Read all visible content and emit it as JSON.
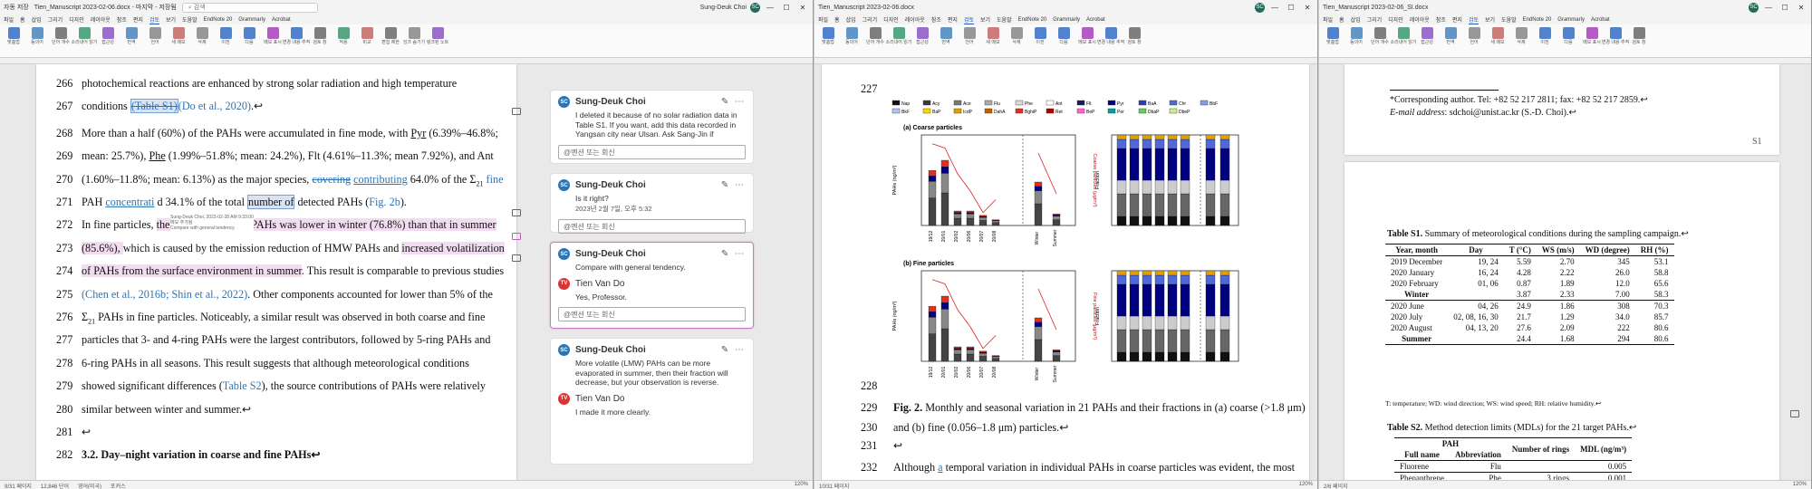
{
  "window1": {
    "title": "Tien_Manuscript 2023-02-06.docx - 마지막 - 저장됨",
    "autosave": "자동 저장",
    "search": "검색",
    "user": "Sung-Deuk Choi",
    "user_initials": "SC",
    "menu": [
      "파일",
      "홈",
      "삽입",
      "그리기",
      "디자인",
      "레이아웃",
      "참조",
      "편지",
      "검토",
      "보기",
      "도움말",
      "EndNote 20",
      "Grammarly",
      "Acrobat"
    ],
    "active_menu": "검토",
    "ribbon": [
      {
        "label": "맞춤법",
        "icon": "spellcheck-icon"
      },
      {
        "label": "동의어",
        "icon": "thesaurus-icon"
      },
      {
        "label": "단어 개수",
        "icon": "wordcount-icon"
      },
      {
        "label": "소리내어 읽기",
        "icon": "readaloud-icon"
      },
      {
        "label": "접근성",
        "icon": "accessibility-icon"
      },
      {
        "label": "번역",
        "icon": "translate-icon"
      },
      {
        "label": "언어",
        "icon": "language-icon"
      },
      {
        "label": "새 메모",
        "icon": "newcomment-icon"
      },
      {
        "label": "삭제",
        "icon": "delete-icon"
      },
      {
        "label": "이전",
        "icon": "previous-icon"
      },
      {
        "label": "다음",
        "icon": "next-icon"
      },
      {
        "label": "메모 표시",
        "icon": "showcomments-icon"
      },
      {
        "label": "변경 내용 추적",
        "icon": "track-icon"
      },
      {
        "label": "검토 창",
        "icon": "reviewpane-icon"
      },
      {
        "label": "적용",
        "icon": "accept-icon"
      },
      {
        "label": "비교",
        "icon": "compare-icon"
      },
      {
        "label": "편집 제한",
        "icon": "protect-icon"
      },
      {
        "label": "잉크 숨기기",
        "icon": "ink-icon"
      },
      {
        "label": "링크된 노트",
        "icon": "onenote-icon"
      }
    ],
    "status": {
      "page": "9/31 페이지",
      "words": "12,846 단어",
      "lang": "영어(미국)",
      "focus": "포커스",
      "zoom": "120%"
    },
    "lines": [
      {
        "num": "266",
        "segs": [
          {
            "t": "photochemical reactions are enhanced by strong solar radiation and high temperature",
            "c": ""
          }
        ]
      },
      {
        "num": "267",
        "segs": [
          {
            "t": "conditions ",
            "c": ""
          },
          {
            "t": "(Table S1)",
            "c": "del sel"
          },
          {
            "t": "(Do et al., 2020)",
            "c": "cite"
          },
          {
            "t": ".↩",
            "c": ""
          }
        ]
      },
      {
        "num": "268",
        "segs": [
          {
            "t": "More than a half (60%) of the PAHs were accumulated in fine mode, with ",
            "c": ""
          },
          {
            "t": "Pyr",
            "c": "u"
          },
          {
            "t": " (6.39%–46.8%;",
            "c": ""
          }
        ]
      },
      {
        "num": "269",
        "segs": [
          {
            "t": "mean: 25.7%), ",
            "c": ""
          },
          {
            "t": "Phe",
            "c": "u"
          },
          {
            "t": " (1.99%–51.8%; mean: 24.2%), Flt (4.61%–11.3%; mean 7.92%), and Ant",
            "c": ""
          }
        ]
      },
      {
        "num": "270",
        "segs": [
          {
            "t": "(1.60%–11.8%; mean: 6.13%) as the major species, ",
            "c": ""
          },
          {
            "t": "covering",
            "c": "del"
          },
          {
            "t": " ",
            "c": ""
          },
          {
            "t": "contributing",
            "c": "ins"
          },
          {
            "t": " 64.0% of the Σ",
            "c": ""
          },
          {
            "t": "21",
            "c": "sub"
          },
          {
            "t": " ",
            "c": ""
          },
          {
            "t": "fine",
            "c": "cite"
          }
        ]
      },
      {
        "num": "271",
        "segs": [
          {
            "t": "PAH ",
            "c": ""
          },
          {
            "t": "concentrati",
            "c": "ins"
          },
          {
            "t": "                            ",
            "c": ""
          },
          {
            "t": "d 34.1% of the total ",
            "c": ""
          },
          {
            "t": "number of",
            "c": "sel"
          },
          {
            "t": " detected PAHs (",
            "c": ""
          },
          {
            "t": "Fig. 2b",
            "c": "cite"
          },
          {
            "t": ").",
            "c": ""
          }
        ]
      },
      {
        "num": "272",
        "segs": [
          {
            "t": "In fine particles, ",
            "c": ""
          },
          {
            "t": "the fraction of LMW PAHs was lower in winter (76.8%) than that in summer",
            "c": "hl"
          }
        ]
      },
      {
        "num": "273",
        "segs": [
          {
            "t": "(85.6%), ",
            "c": "hl"
          },
          {
            "t": "which is caused by the emission reduction of HMW PAHs and ",
            "c": ""
          },
          {
            "t": "increased volatilization",
            "c": "hl"
          }
        ]
      },
      {
        "num": "274",
        "segs": [
          {
            "t": "of PAHs from the surface environment in summer",
            "c": "hl"
          },
          {
            "t": ". This result is comparable to previous studies",
            "c": ""
          }
        ]
      },
      {
        "num": "275",
        "segs": [
          {
            "t": "(Chen et al., 2016b; Shin et al., 2022)",
            "c": "cite"
          },
          {
            "t": ". Other components accounted for lower than 5% of the",
            "c": ""
          }
        ]
      },
      {
        "num": "276",
        "segs": [
          {
            "t": "Σ",
            "c": ""
          },
          {
            "t": "21",
            "c": "sub"
          },
          {
            "t": " PAHs in fine particles. Noticeably, a similar result was observed in both coarse and fine",
            "c": ""
          }
        ]
      },
      {
        "num": "277",
        "segs": [
          {
            "t": "particles that 3- and 4-ring PAHs were the largest contributors, followed by 5-ring PAHs and",
            "c": ""
          }
        ]
      },
      {
        "num": "278",
        "segs": [
          {
            "t": "6-ring PAHs in all seasons. This result suggests that although meteorological conditions",
            "c": ""
          }
        ]
      },
      {
        "num": "279",
        "segs": [
          {
            "t": "showed significant differences (",
            "c": ""
          },
          {
            "t": "Table S2",
            "c": "cite"
          },
          {
            "t": "), the source contributions of PAHs were relatively",
            "c": ""
          }
        ]
      },
      {
        "num": "280",
        "segs": [
          {
            "t": "similar between winter and summer.↩",
            "c": ""
          }
        ]
      },
      {
        "num": "281",
        "segs": [
          {
            "t": "↩",
            "c": ""
          }
        ]
      },
      {
        "num": "282",
        "segs": [
          {
            "t": "3.2. Day–night variation in coarse and fine PAHs↩",
            "c": "b"
          }
        ]
      }
    ],
    "tooltip": {
      "line1": "Sung-Deuk Choi, 2023-02-28 AM 9:33:00",
      "line2": "메모 추가됨",
      "line3": "Compare with general tendency."
    },
    "comments": [
      {
        "author": "Sung-Deuk Choi",
        "initials": "SC",
        "text": "I deleted it because of no solar radiation data in Table S1. If you want, add this data recorded in Yangsan city near Ulsan. Ask Sang-Jin if",
        "reply": "@멘션 또는 회신"
      },
      {
        "author": "Sung-Deuk Choi",
        "initials": "SC",
        "text": "Is it right?",
        "date": "2023년 2월 7일, 오후 5:32",
        "reply": "@멘션 또는 회신"
      },
      {
        "author": "Sung-Deuk Choi",
        "initials": "SC",
        "text": "Compare with general tendency.",
        "reply_author": "Tien Van Do",
        "reply_initials": "TV",
        "reply_text": "Yes, Professor.",
        "reply": "@멘션 또는 회신"
      },
      {
        "author": "Sung-Deuk Choi",
        "initials": "SC",
        "text": "More volatile (LMW) PAHs can be more evaporated in summer, then their fraction will decrease, but your observation is reverse.",
        "reply_author": "Tien Van Do",
        "reply_initials": "TV",
        "reply_text": "I made it more clearly."
      }
    ]
  },
  "window2": {
    "title": "Tien_Manuscript 2023-02-06.docx",
    "menu": [
      "파일",
      "홈",
      "삽입",
      "그리기",
      "디자인",
      "레이아웃",
      "참조",
      "편지",
      "검토",
      "보기",
      "도움말",
      "EndNote 20",
      "Grammarly",
      "Acrobat"
    ],
    "line227": "227",
    "line228": "228",
    "fig_caption": "Fig. 2.",
    "fig_caption_rest": " Monthly and seasonal variation in 21 PAHs and their fractions in (a) coarse (>1.8 μm)",
    "fig_caption_2": "and (b) fine (0.056–1.8 μm) particles.↩",
    "line229": "229",
    "line230": "230",
    "line231": "231",
    "line232": "232",
    "text231": "↩",
    "text232a": "Although ",
    "text232b": "a",
    "text232c": " temporal variation in individual PAHs in coarse particles was evident, the most",
    "legend": [
      "Nap",
      "Acy",
      "Ace",
      "Flu",
      "Phe",
      "Ant",
      "Flt",
      "Pyr",
      "BaA",
      "Chr",
      "BbF",
      "BkF",
      "BaP",
      "IcdP",
      "DahA",
      "BghiP",
      "Ret",
      "BeP",
      "Per",
      "DbaP",
      "DbeP"
    ],
    "panel_a": "(a) Coarse particles",
    "panel_b": "(b) Fine particles",
    "ylab_conc": "PAHs (ng/m³)",
    "ylab_frac": "Fraction",
    "ylab_red_a": "Coarse particles (μg/m³)",
    "ylab_red_b": "Fine particles (μg/m³)",
    "months": [
      "19/12",
      "20/01",
      "20/02",
      "20/06",
      "20/07",
      "20/08"
    ],
    "seasons": [
      "Winter",
      "Summer"
    ],
    "status": {
      "page": "10/31 페이지",
      "zoom": "120%"
    }
  },
  "window3": {
    "title": "Tien_Manuscript 2023-02-06_SI.docx",
    "menu": [
      "파일",
      "홈",
      "삽입",
      "그리기",
      "디자인",
      "레이아웃",
      "참조",
      "편지",
      "검토",
      "보기",
      "도움말",
      "EndNote 20",
      "Grammarly",
      "Acrobat"
    ],
    "corr": "*Corresponding author. Tel: +82 52 217 2811; fax: +82 52 217 2859.↩",
    "email_label": "E-mail address",
    "email": ": sdchoi@unist.ac.kr (S.-D. Choi).↩",
    "s1": "S1",
    "table1_title": "Table S1.",
    "table1_rest": " Summary of meteorological conditions during the sampling campaign.↩",
    "table1_head": [
      "Year, month",
      "Day",
      "T (°C)",
      "WS (m/s)",
      "WD (degree)",
      "RH (%)"
    ],
    "table1_rows": [
      [
        "2019 December",
        "19, 24",
        "5.59",
        "2.70",
        "345",
        "53.1"
      ],
      [
        "2020 January",
        "16, 24",
        "4.28",
        "2.22",
        "26.0",
        "58.8"
      ],
      [
        "2020 February",
        "01, 06",
        "0.87",
        "1.89",
        "12.0",
        "65.6"
      ],
      [
        "Winter",
        "",
        "3.87",
        "2.33",
        "7.00",
        "58.3"
      ],
      [
        "2020 June",
        "04, 26",
        "24.9",
        "1.86",
        "308",
        "70.3"
      ],
      [
        "2020 July",
        "02, 08, 16, 30",
        "21.7",
        "1.29",
        "34.0",
        "85.7"
      ],
      [
        "2020 August",
        "04, 13, 20",
        "27.6",
        "2.09",
        "222",
        "80.6"
      ],
      [
        "Summer",
        "",
        "24.4",
        "1.68",
        "294",
        "80.6"
      ]
    ],
    "table1_note": "T: temperature; WD: wind direction; WS: wind speed; RH: relative humidity.↩",
    "table2_title": "Table S2.",
    "table2_rest": " Method detection limits (MDLs) for the 21 target PAHs.↩",
    "table2_head": [
      "PAH",
      "Number of rings",
      "MDL (ng/m³)"
    ],
    "table2_sub": [
      "Full name",
      "Abbreviation"
    ],
    "table2_rows": [
      [
        "Fluorene",
        "Flu",
        "",
        "0.005"
      ],
      [
        "Phenanthrene",
        "Phe",
        "3 rings",
        "0.001"
      ]
    ],
    "status": {
      "page": "2/6 페이지",
      "zoom": "120%"
    }
  }
}
